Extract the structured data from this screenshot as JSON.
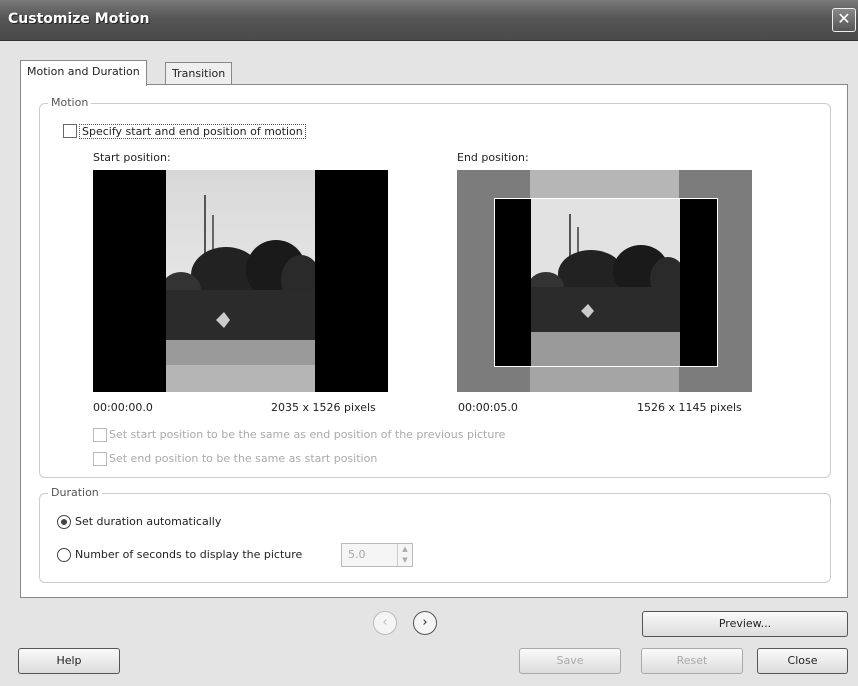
{
  "window": {
    "title": "Customize Motion",
    "close_glyph": "✕"
  },
  "tabs": [
    {
      "label": "Motion and Duration",
      "active": true
    },
    {
      "label": "Transition",
      "active": false
    }
  ],
  "motion": {
    "group_label": "Motion",
    "specify_label": "Specify start and end position of motion",
    "specify_checked": false,
    "start": {
      "label": "Start position:",
      "time": "00:00:00.0",
      "size": "2035 x 1526 pixels"
    },
    "end": {
      "label": "End position:",
      "time": "00:00:05.0",
      "size": "1526 x 1145 pixels"
    },
    "opt_start_same_label": "Set start position to be the same as end position of the previous picture",
    "opt_end_same_label": "Set end position to be the same as start position"
  },
  "duration": {
    "group_label": "Duration",
    "auto_label": "Set duration automatically",
    "manual_label": "Number of seconds to display the picture",
    "seconds_value": "5.0",
    "selected": "auto"
  },
  "nav": {
    "prev_glyph": "‹",
    "next_glyph": "›"
  },
  "buttons": {
    "preview": "Preview...",
    "help": "Help",
    "save": "Save",
    "reset": "Reset",
    "close": "Close"
  },
  "colors": {
    "title_bar": "#555555",
    "dialog_bg": "#e4e4e4"
  }
}
